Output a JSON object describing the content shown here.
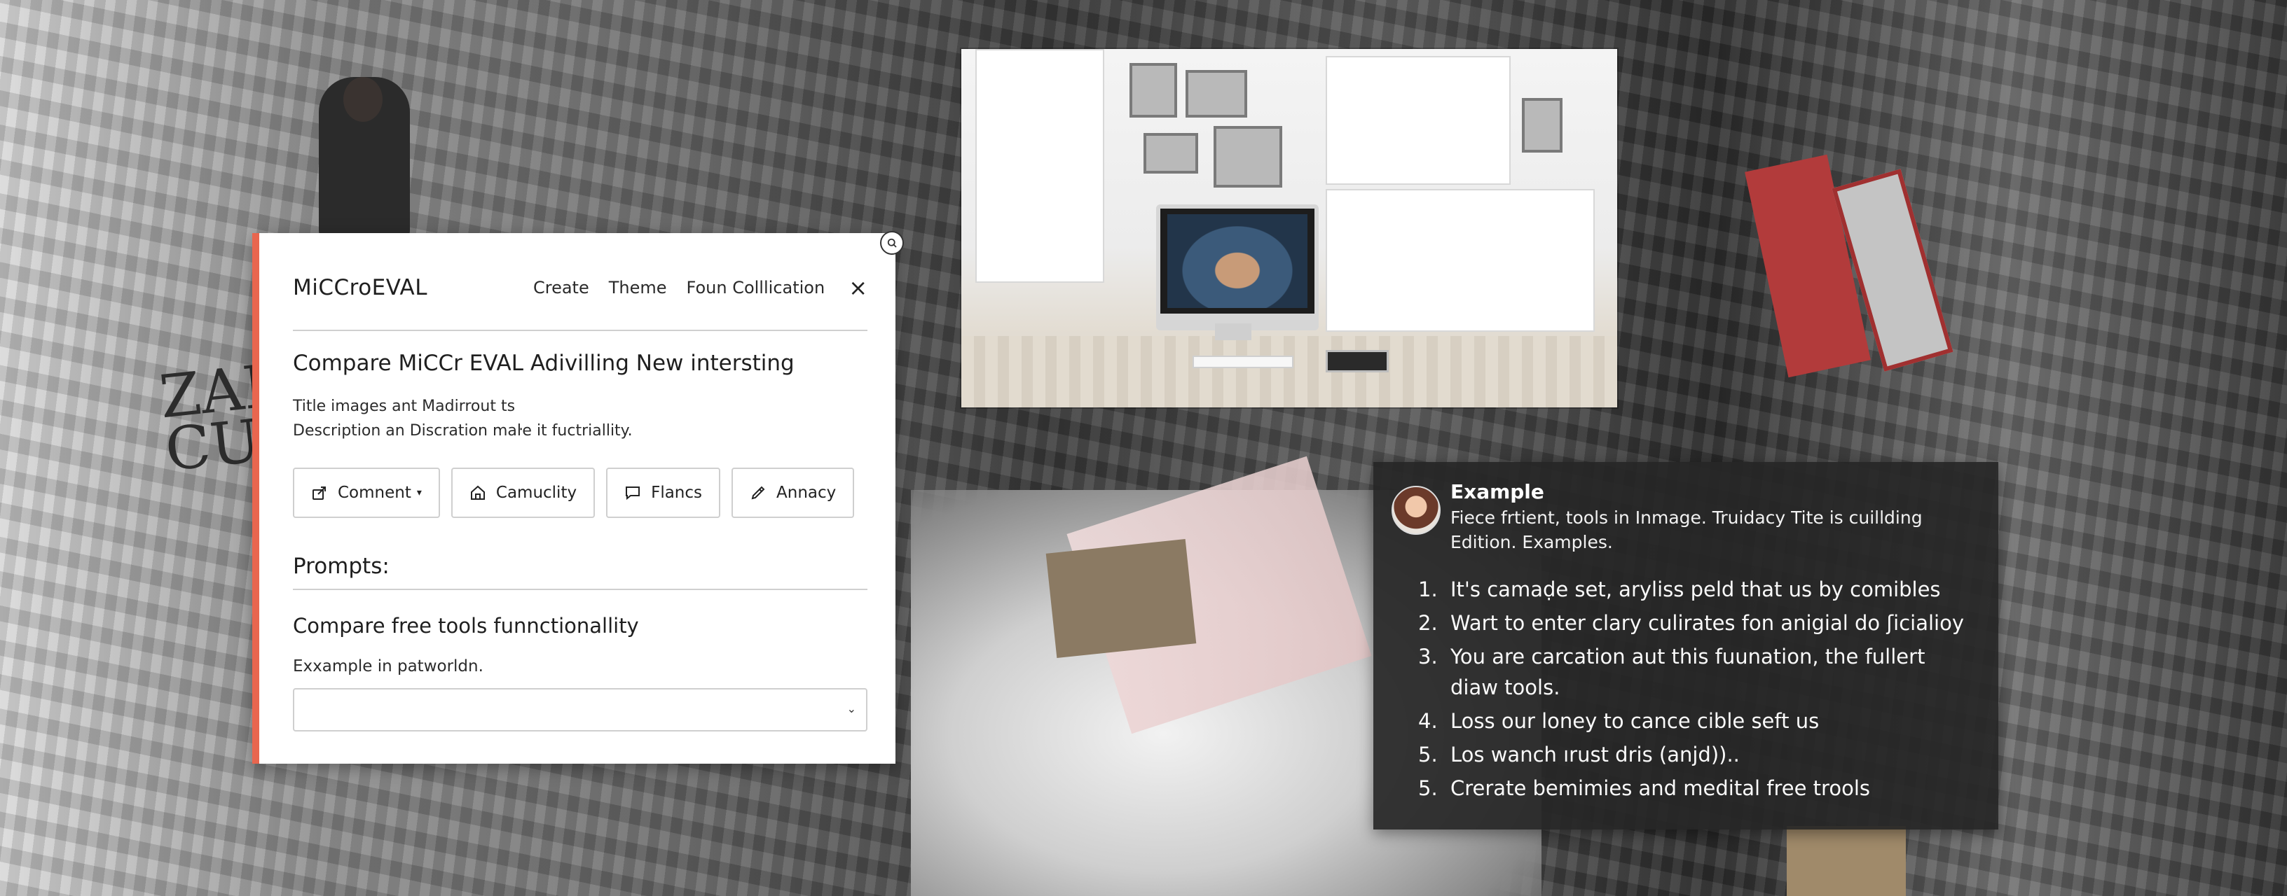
{
  "dialog": {
    "brand": "MiCCroEVAL",
    "nav": [
      "Create",
      "Theme",
      "Foun Colllication"
    ],
    "close_glyph": "×",
    "title": "Compare MiCCr EVAL Adivilling New intersting",
    "desc_line1": "Title images ant Madirrout ts",
    "desc_line2": "Description an Discration maŀe it fuctriallity.",
    "buttons": [
      {
        "label": "Comnent",
        "icon": "export-icon"
      },
      {
        "label": "Camuclity",
        "icon": "home-icon"
      },
      {
        "label": "Flancs",
        "icon": "comment-icon"
      },
      {
        "label": "Annacy",
        "icon": "pen-icon"
      }
    ],
    "prompts_heading": "Prompts:",
    "subheading": "Compare free tools funnctionallity",
    "example_label": "Exxample in patworldn.",
    "select_value": ""
  },
  "panel": {
    "name": "Example",
    "description": "Fiece frtient, tools in Inmage. Truidacy Tite is cuillding Edition. Examples.",
    "items": [
      {
        "num": "1.",
        "text": "It's camaḍe set, aryliss peld that us by comibles"
      },
      {
        "num": "2.",
        "text": "Wart to enter clary culirates fon anigial do ʃicialioy"
      },
      {
        "num": "3.",
        "text": "You are carcation aut this fuunation, the fullert diaw tools."
      },
      {
        "num": "4.",
        "text": "Loss our loney to cance cible seft us"
      },
      {
        "num": "5.",
        "text": "Los wanch ırust dris (anjd)).."
      },
      {
        "num": "5.",
        "text": "Crerate bemimies and medital free trools"
      }
    ]
  },
  "background": {
    "graffiti": "ZAL\nCUC"
  },
  "colors": {
    "accent": "#e8664f",
    "panel_bg": "#262626",
    "dialog_bg": "#ffffff"
  }
}
